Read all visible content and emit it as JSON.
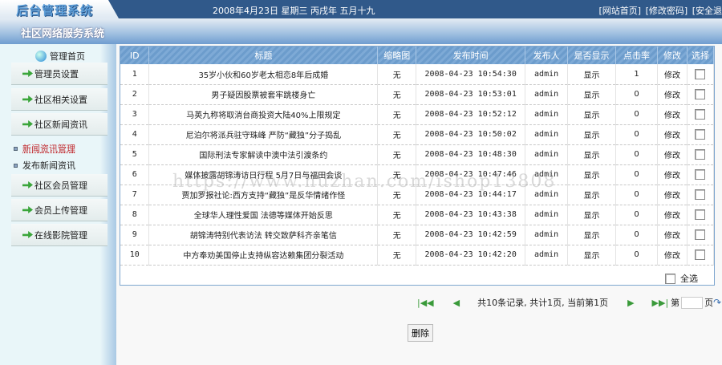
{
  "header": {
    "logo": "后台管理系统",
    "date": "2008年4月23日 星期三 丙戌年 五月十九",
    "links": [
      "[网站首页]",
      "[修改密码]",
      "[安全退"
    ],
    "system_name": "社区网络服务系统"
  },
  "sidebar": {
    "home": "管理首页",
    "items": [
      "管理员设置",
      "社区相关设置",
      "社区新闻资讯",
      "社区会员管理",
      "会员上传管理",
      "在线影院管理"
    ],
    "subitems": [
      "新闻资讯管理",
      "发布新闻资讯"
    ]
  },
  "table": {
    "headers": [
      "ID",
      "标题",
      "缩略图",
      "发布时间",
      "发布人",
      "是否显示",
      "点击率",
      "修改",
      "选择"
    ],
    "rows": [
      [
        "1",
        "35岁小伙和60岁老太相恋8年后成婚",
        "无",
        "2008-04-23 10:54:30",
        "admin",
        "显示",
        "1",
        "修改"
      ],
      [
        "2",
        "男子疑因股票被套牢跳楼身亡",
        "无",
        "2008-04-23 10:53:01",
        "admin",
        "显示",
        "0",
        "修改"
      ],
      [
        "3",
        "马英九称将取消台商投资大陆40%上限规定",
        "无",
        "2008-04-23 10:52:12",
        "admin",
        "显示",
        "0",
        "修改"
      ],
      [
        "4",
        "尼泊尔将派兵驻守珠峰 严防“藏独”分子捣乱",
        "无",
        "2008-04-23 10:50:02",
        "admin",
        "显示",
        "0",
        "修改"
      ],
      [
        "5",
        "国际刑法专家解读中澳中法引渡条约",
        "无",
        "2008-04-23 10:48:30",
        "admin",
        "显示",
        "0",
        "修改"
      ],
      [
        "6",
        "媒体披露胡锦涛访日行程 5月7日与福田会谈",
        "无",
        "2008-04-23 10:47:46",
        "admin",
        "显示",
        "0",
        "修改"
      ],
      [
        "7",
        "贾加罗报社论:西方支持“藏独”是反华情绪作怪",
        "无",
        "2008-04-23 10:44:17",
        "admin",
        "显示",
        "0",
        "修改"
      ],
      [
        "8",
        "全球华人理性爱国 法德等媒体开始反思",
        "无",
        "2008-04-23 10:43:38",
        "admin",
        "显示",
        "0",
        "修改"
      ],
      [
        "9",
        "胡锦涛特别代表访法 转交致萨科齐亲笔信",
        "无",
        "2008-04-23 10:42:59",
        "admin",
        "显示",
        "0",
        "修改"
      ],
      [
        "10",
        "中方奉劝美国停止支持纵容达赖集团分裂活动",
        "无",
        "2008-04-23 10:42:20",
        "admin",
        "显示",
        "0",
        "修改"
      ]
    ],
    "select_all": "全选"
  },
  "pager": {
    "first": "|◀◀",
    "prev": "◀",
    "info": "共10条记录, 共计1页, 当前第1页",
    "next": "▶",
    "last": "▶▶|",
    "page_prefix": "第",
    "page_suffix": "页",
    "page_value": ""
  },
  "delete_label": "删除",
  "watermark": "https://www.huzhan.com/ishop13808"
}
